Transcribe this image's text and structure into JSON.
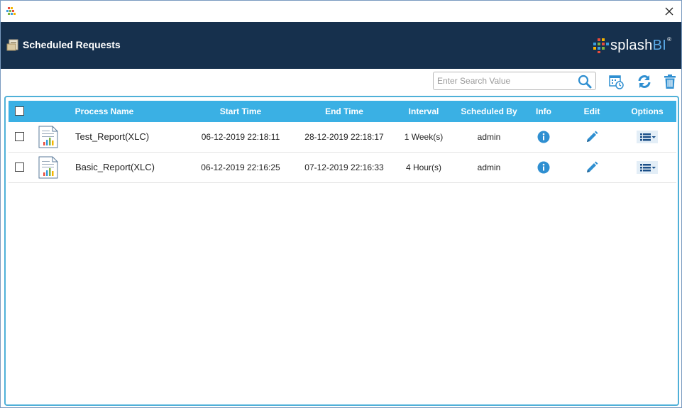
{
  "window": {
    "close_glyph": "✕",
    "close_icon": "close-icon",
    "app_icon": "splashbi-app-icon"
  },
  "header": {
    "title": "Scheduled Requests",
    "title_icon": "scheduled-requests-icon",
    "logo_text_main": "splash",
    "logo_text_accent": "BI",
    "logo_reg": "®",
    "background": "#16304d"
  },
  "toolbar": {
    "search_placeholder": "Enter Search Value",
    "search_value": "",
    "search_icon": "search-icon",
    "schedule_icon": "calendar-clock-icon",
    "refresh_icon": "refresh-icon",
    "delete_icon": "trash-icon",
    "accent": "#2f8fd1"
  },
  "table": {
    "header_bg": "#3ab0e4",
    "columns": {
      "process_name": "Process Name",
      "start_time": "Start Time",
      "end_time": "End Time",
      "interval": "Interval",
      "scheduled_by": "Scheduled By",
      "info": "Info",
      "edit": "Edit",
      "options": "Options"
    },
    "rows": [
      {
        "process_name": "Test_Report(XLC)",
        "start_time": "06-12-2019 22:18:11",
        "end_time": "28-12-2019 22:18:17",
        "interval": "1 Week(s)",
        "scheduled_by": "admin"
      },
      {
        "process_name": "Basic_Report(XLC)",
        "start_time": "06-12-2019 22:16:25",
        "end_time": "07-12-2019 22:16:33",
        "interval": "4 Hour(s)",
        "scheduled_by": "admin"
      }
    ]
  }
}
